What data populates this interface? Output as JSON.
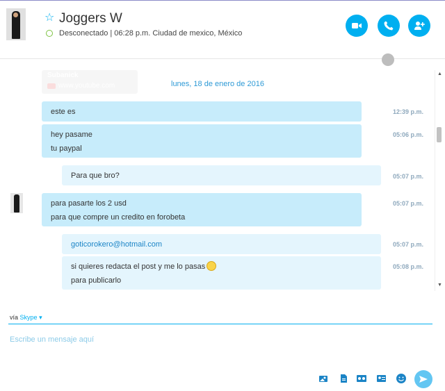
{
  "header": {
    "contact_name": "Joggers W",
    "status_text": "Desconectado | 06:28 p.m. Ciudad de mexico, México",
    "buttons": [
      {
        "name": "video-call-button",
        "icon": "video-icon"
      },
      {
        "name": "voice-call-button",
        "icon": "phone-icon"
      },
      {
        "name": "add-people-button",
        "icon": "add-person-icon"
      }
    ],
    "accent_color": "#00aff0",
    "status_color": "#7dc242"
  },
  "conversation": {
    "previous_card": {
      "title": "Subanick",
      "subtitle": "www.youtube.com"
    },
    "date": "lunes, 18 de enero de 2016",
    "messages": [
      {
        "direction": "out",
        "lines": [
          "este es"
        ],
        "time": "12:39 p.m."
      },
      {
        "direction": "out",
        "lines": [
          "hey pasame",
          "tu paypal"
        ],
        "time": "05:06 p.m."
      },
      {
        "direction": "in",
        "lines": [
          "Para que bro?"
        ],
        "time": "05:07 p.m."
      },
      {
        "direction": "out",
        "lines": [
          "para pasarte los 2 usd",
          "para que compre un credito en forobeta"
        ],
        "time": "05:07 p.m."
      },
      {
        "direction": "in",
        "lines": [
          "goticorokero@hotmail.com"
        ],
        "time": "05:07 p.m."
      },
      {
        "direction": "in",
        "lines": [
          "si quieres redacta el post y me lo pasas",
          "para publicarlo"
        ],
        "time": "05:08 p.m."
      }
    ]
  },
  "compose": {
    "via_prefix": "vía",
    "via_service": "Skype",
    "placeholder": "Escribe un mensaje aquí",
    "tools": [
      "send-photo-icon",
      "send-file-icon",
      "video-message-icon",
      "send-contact-icon",
      "emoticon-icon"
    ]
  }
}
